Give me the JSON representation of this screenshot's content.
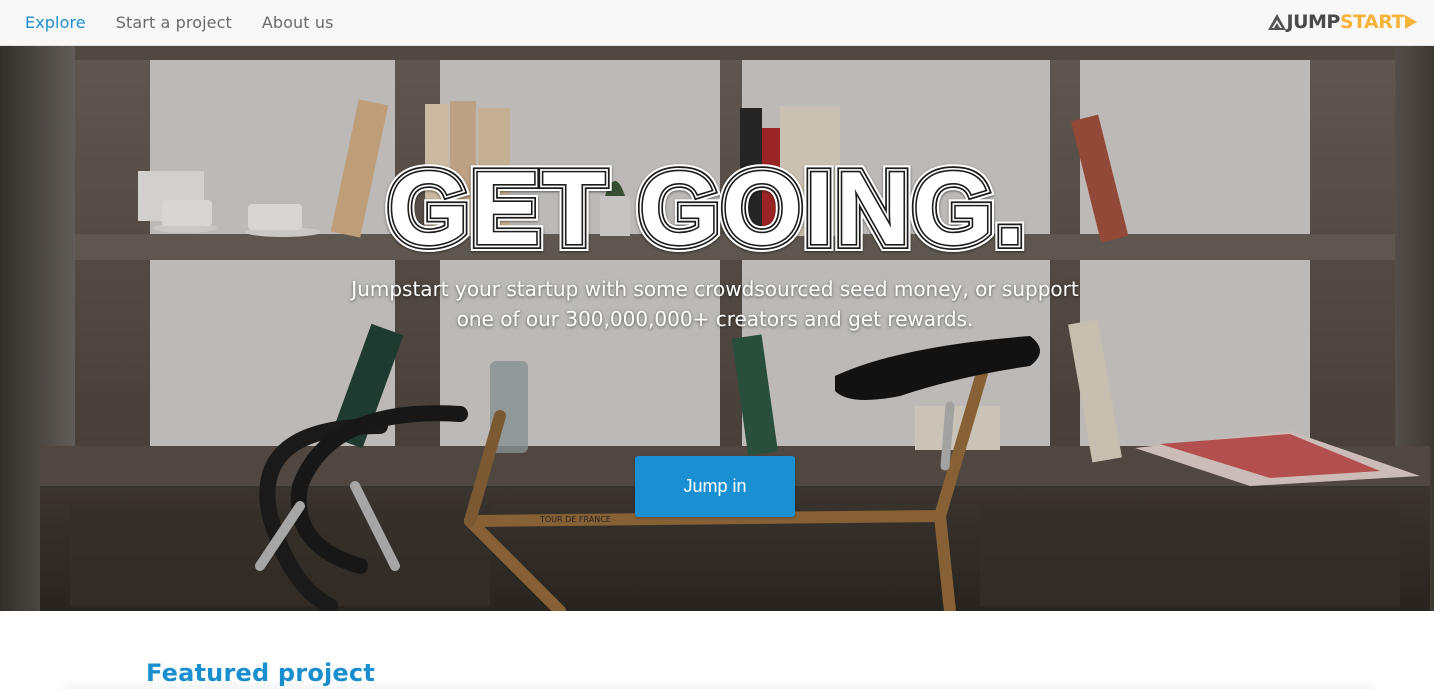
{
  "nav": {
    "links": [
      {
        "label": "Explore",
        "active": true
      },
      {
        "label": "Start a project",
        "active": false
      },
      {
        "label": "About us",
        "active": false
      }
    ],
    "logo": {
      "part1": "JUMP",
      "part2": "START",
      "icon": "triangle-play-logo-icon"
    }
  },
  "hero": {
    "headline": "GET GOING.",
    "subtitle_line1": "Jumpstart your startup with some crowdsourced seed money, or support",
    "subtitle_line2": "one of our 300,000,000+ creators and get rewards.",
    "cta_label": "Jump in",
    "background": "bookshelf-and-bicycle-photo"
  },
  "featured": {
    "title": "Featured project"
  },
  "colors": {
    "accent": "#1a8fcf",
    "logo_orange": "#f6b33a",
    "nav_bg": "#f8f8f8"
  }
}
